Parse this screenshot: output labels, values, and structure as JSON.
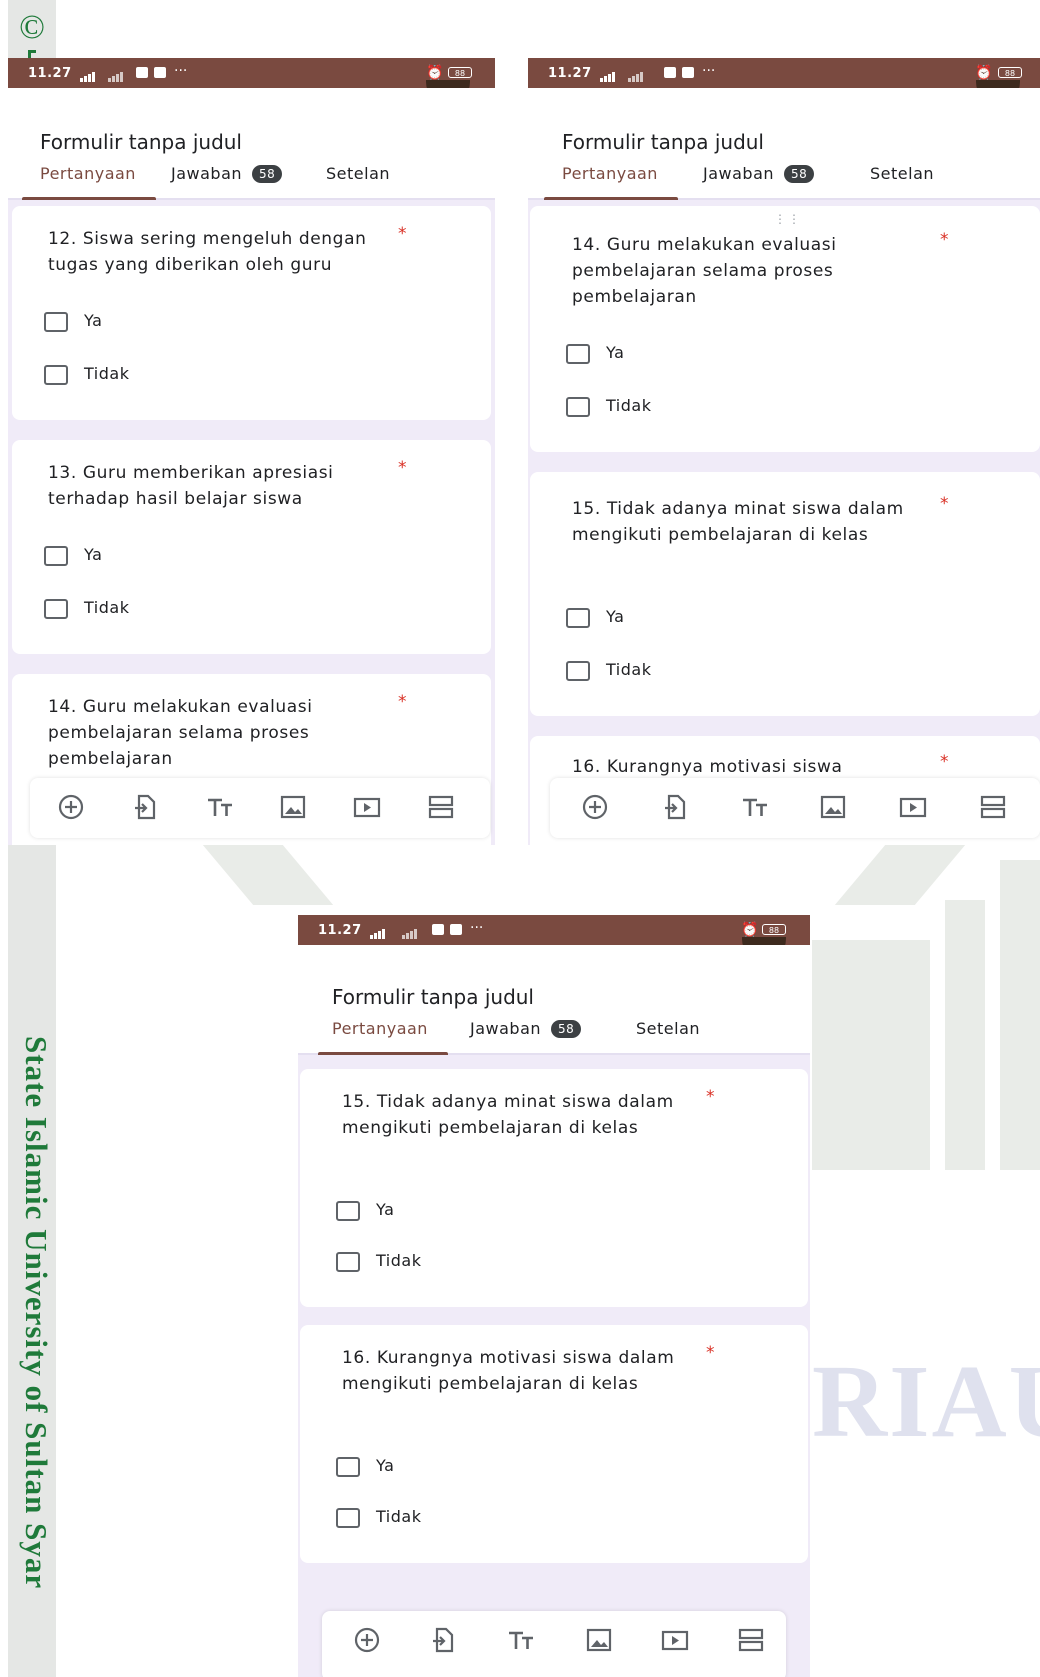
{
  "side": {
    "copyright_symbol": "©",
    "vertical_text": "State Islamic University of Sultan Syar"
  },
  "watermark": {
    "riau": "RIAU"
  },
  "status_bar": {
    "time": "11.27",
    "network": "4G",
    "dots": "···",
    "alarm_icon": "alarm-icon",
    "battery": "88"
  },
  "form": {
    "title": "Formulir tanpa judul",
    "tabs": {
      "questions": "Pertanyaan",
      "responses": "Jawaban",
      "responses_count": "58",
      "settings": "Setelan"
    }
  },
  "options": {
    "yes": "Ya",
    "no": "Tidak"
  },
  "required_mark": "*",
  "drag_handle": "⋮⋮",
  "questions": {
    "q12": "12. Siswa sering mengeluh dengan tugas yang diberikan oleh guru",
    "q13": "13. Guru memberikan apresiasi terhadap hasil belajar siswa",
    "q14": "14. Guru melakukan evaluasi pembelajaran selama proses pembelajaran",
    "q15": "15. Tidak adanya minat siswa dalam mengikuti pembelajaran di kelas",
    "q16": "16. Kurangnya motivasi siswa dalam mengikuti pembelajaran di kelas",
    "q16_partial": "16. Kurangnya motivasi siswa"
  },
  "toolbar": {
    "icons": [
      "add-question-icon",
      "import-questions-icon",
      "add-title-icon",
      "add-image-icon",
      "add-video-icon",
      "add-section-icon"
    ]
  },
  "colors": {
    "status_bar": "#7a4a40",
    "accent": "#7a4a40",
    "form_purple": "#673ab7",
    "form_background": "#f0ebf8",
    "required": "#d93025",
    "badge": "#3c4043",
    "side_text": "#1f7a3a"
  }
}
